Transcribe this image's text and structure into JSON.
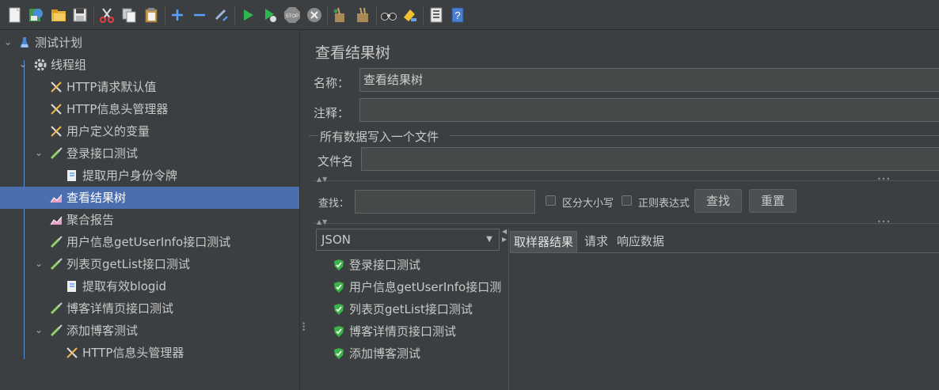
{
  "toolbar": {
    "buttons": [
      {
        "name": "new-icon"
      },
      {
        "name": "templates-icon"
      },
      {
        "name": "open-icon"
      },
      {
        "name": "save-icon"
      },
      {
        "name": "cut-icon"
      },
      {
        "name": "copy-icon"
      },
      {
        "name": "paste-icon"
      },
      {
        "name": "expand-icon"
      },
      {
        "name": "collapse-icon"
      },
      {
        "name": "toggle-icon"
      },
      {
        "name": "start-icon"
      },
      {
        "name": "start-no-pause-icon"
      },
      {
        "name": "stop-icon"
      },
      {
        "name": "shutdown-icon"
      },
      {
        "name": "clear-icon"
      },
      {
        "name": "clear-all-icon"
      },
      {
        "name": "search-icon"
      },
      {
        "name": "reset-search-icon"
      },
      {
        "name": "function-helper-icon"
      },
      {
        "name": "help-icon"
      }
    ],
    "colors": {
      "play": "#2db84d",
      "stop": "#8a8a8a",
      "accent": "#4b6eaf"
    }
  },
  "tree": {
    "items": [
      {
        "label": "测试计划",
        "icon": "test-plan-icon",
        "level": 0,
        "expanded": true
      },
      {
        "label": "线程组",
        "icon": "thread-group-gear-icon",
        "level": 1,
        "expanded": true
      },
      {
        "label": "HTTP请求默认值",
        "icon": "config-tools-icon",
        "level": 2
      },
      {
        "label": "HTTP信息头管理器",
        "icon": "config-tools-icon",
        "level": 2
      },
      {
        "label": "用户定义的变量",
        "icon": "config-tools-icon",
        "level": 2
      },
      {
        "label": "登录接口测试",
        "icon": "sampler-pipette-icon",
        "level": 2,
        "expanded": true
      },
      {
        "label": "提取用户身份令牌",
        "icon": "post-processor-icon",
        "level": 3
      },
      {
        "label": "查看结果树",
        "icon": "listener-chart-icon",
        "level": 2,
        "selected": true
      },
      {
        "label": "聚合报告",
        "icon": "listener-chart-icon",
        "level": 2
      },
      {
        "label": "用户信息getUserInfo接口测试",
        "icon": "sampler-pipette-icon",
        "level": 2
      },
      {
        "label": "列表页getList接口测试",
        "icon": "sampler-pipette-icon",
        "level": 2,
        "expanded": true
      },
      {
        "label": "提取有效blogid",
        "icon": "post-processor-icon",
        "level": 3
      },
      {
        "label": "博客详情页接口测试",
        "icon": "sampler-pipette-icon",
        "level": 2
      },
      {
        "label": "添加博客测试",
        "icon": "sampler-pipette-icon",
        "level": 2,
        "expanded": true
      },
      {
        "label": "HTTP信息头管理器",
        "icon": "config-tools-icon",
        "level": 3
      }
    ]
  },
  "panel": {
    "title": "查看结果树",
    "name_label": "名称：",
    "name_value": "查看结果树",
    "comment_label": "注释：",
    "comment_value": "",
    "file_group_title": "所有数据写入一个文件",
    "filename_label": "文件名",
    "filename_value": "",
    "search_label": "查找：",
    "search_value": "",
    "case_label": "区分大小写",
    "regex_label": "正则表达式",
    "find_button": "查找",
    "reset_button": "重置",
    "renderer": "JSON",
    "results": [
      "登录接口测试",
      "用户信息getUserInfo接口测试",
      "列表页getList接口测试",
      "博客详情页接口测试",
      "添加博客测试"
    ],
    "tabs": [
      "取样器结果",
      "请求",
      "响应数据"
    ],
    "result_color": "#3cb44a"
  }
}
